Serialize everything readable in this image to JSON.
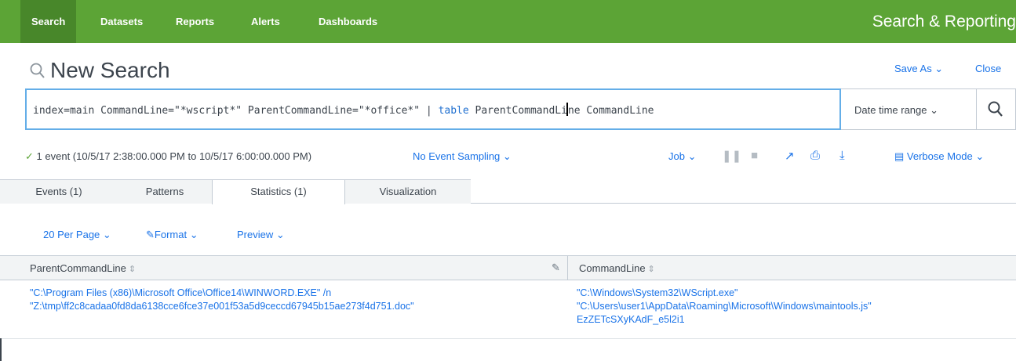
{
  "nav": {
    "items": [
      "Search",
      "Datasets",
      "Reports",
      "Alerts",
      "Dashboards"
    ],
    "app_title": "Search & Reporting"
  },
  "header": {
    "title": "New Search",
    "save_as": "Save As ⌄",
    "close": "Close"
  },
  "search": {
    "query_parts": [
      "index=main CommandLine=\"*wscript*\" ParentCommandLine=\"*office*\" | ",
      "table",
      " ParentCommandLi",
      "ne CommandLine"
    ],
    "time_range": "Date time range ⌄"
  },
  "status": {
    "check": "✓",
    "events": "1 event (10/5/17 2:38:00.000 PM to 10/5/17 6:00:00.000 PM)",
    "sampling": "No Event Sampling ⌄",
    "job": "Job ⌄",
    "verbose": "Verbose Mode ⌄"
  },
  "tabs": [
    "Events (1)",
    "Patterns",
    "Statistics (1)",
    "Visualization"
  ],
  "table_options": {
    "per_page": "20 Per Page ⌄",
    "format": "Format ⌄",
    "preview": "Preview ⌄"
  },
  "table": {
    "columns": [
      "ParentCommandLine",
      "CommandLine"
    ],
    "sort_glyph": "⇕",
    "rows": [
      {
        "parent_line1": "\"C:\\Program Files (x86)\\Microsoft Office\\Office14\\WINWORD.EXE\" /n",
        "parent_line2": "\"Z:\\tmp\\ff2c8cadaa0fd8da6138cce6fce37e001f53a5d9ceccd67945b15ae273f4d751.doc\"",
        "cmd_line1": "\"C:\\Windows\\System32\\WScript.exe\"",
        "cmd_line2": "\"C:\\Users\\user1\\AppData\\Roaming\\Microsoft\\Windows\\maintools.js\"",
        "cmd_line3": "EzZETcSXyKAdF_e5l2i1"
      }
    ]
  },
  "colors": {
    "nav_bg": "#5ca436",
    "nav_active": "#48872a",
    "link": "#1a73e8",
    "focus_border": "#64aee8"
  }
}
